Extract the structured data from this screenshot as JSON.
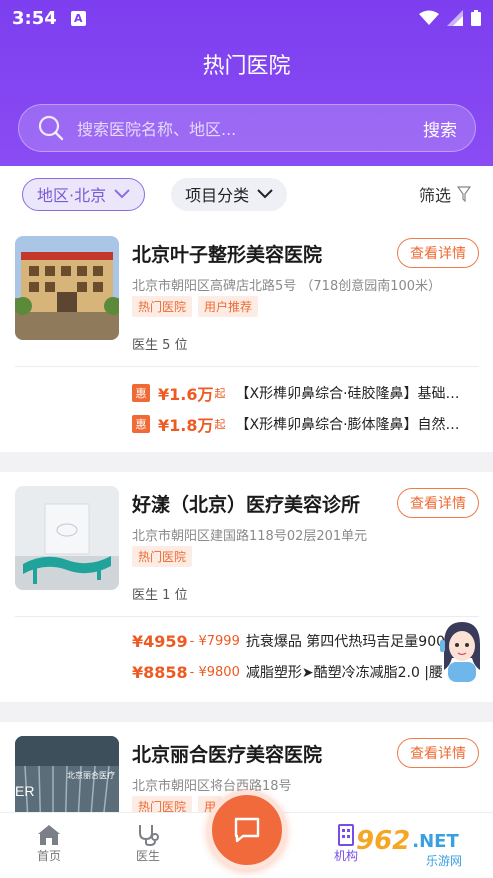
{
  "status_bar": {
    "time": "3:54",
    "app_icon_letter": "A"
  },
  "page_title": "热门医院",
  "search": {
    "placeholder": "搜索医院名称、地区...",
    "button": "搜索"
  },
  "filters": {
    "region": "地区·北京",
    "category": "项目分类",
    "filter": "筛选"
  },
  "hospitals": [
    {
      "name": "北京叶子整形美容医院",
      "address": "北京市朝阳区高碑店北路5号 （718创意园南100米）",
      "tags": [
        "热门医院",
        "用户推荐"
      ],
      "doctor_label": "医生",
      "doctor_count": "5",
      "doctor_unit": "位",
      "detail_button": "查看详情",
      "deals": [
        {
          "badge": "惠",
          "price": "¥1.6万",
          "unit": "起",
          "text": "【X形榫卯鼻综合·硅胶隆鼻】基础…"
        },
        {
          "badge": "惠",
          "price": "¥1.8万",
          "unit": "起",
          "text": "【X形榫卯鼻综合·膨体隆鼻】自然…"
        }
      ]
    },
    {
      "name": "好漾（北京）医疗美容诊所",
      "address": "北京市朝阳区建国路118号02层201单元",
      "tags": [
        "热门医院"
      ],
      "doctor_label": "医生",
      "doctor_count": "1",
      "doctor_unit": "位",
      "detail_button": "查看详情",
      "deals": [
        {
          "price": "¥4959",
          "old_price": "- ¥7999",
          "text": "抗衰爆品 第四代热玛吉足量900"
        },
        {
          "price": "¥8858",
          "old_price": "- ¥9800",
          "text": "减脂塑形➤酷塑冷冻减脂2.0 |腰"
        }
      ]
    },
    {
      "name": "北京丽合医疗美容医院",
      "address": "北京市朝阳区将台西路18号",
      "tags": [
        "热门医院",
        "用"
      ],
      "detail_button": "查看详情",
      "thumb_text": "北京丽合医疗"
    }
  ],
  "bottom_nav": [
    {
      "label": "首页",
      "icon": "home-icon"
    },
    {
      "label": "医生",
      "icon": "stethoscope-icon"
    },
    {
      "label": "机构",
      "icon": "building-icon",
      "active": true
    }
  ],
  "watermark": {
    "logo": "962",
    "net": ".NET",
    "sub": "乐游网"
  },
  "colors": {
    "brand_purple": "#7d3ef0",
    "accent_orange": "#ee6a33"
  }
}
